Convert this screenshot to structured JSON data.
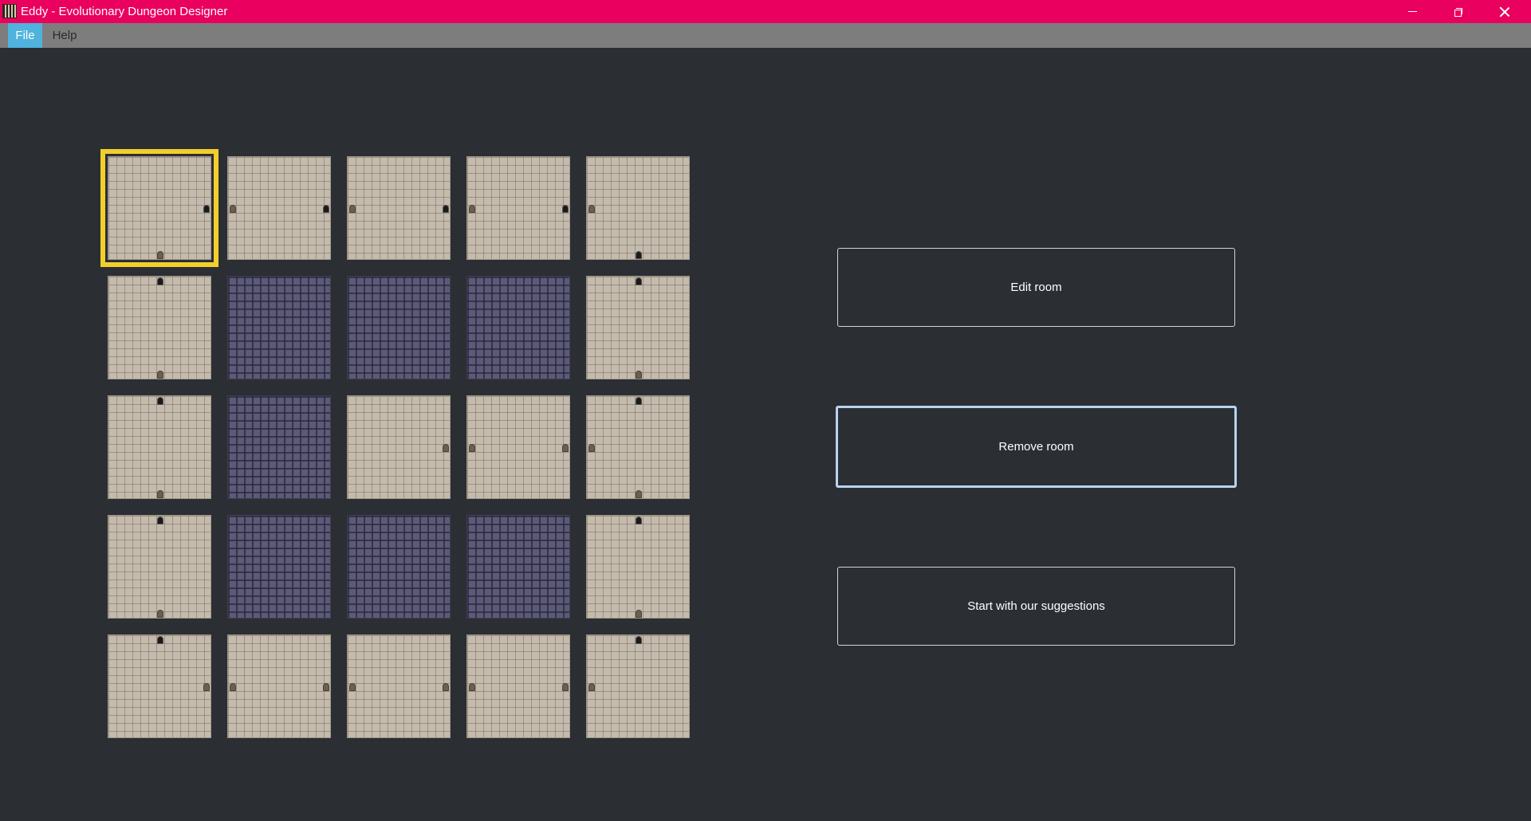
{
  "window": {
    "title": "Eddy - Evolutionary Dungeon Designer",
    "controls": {
      "minimize": "minimize-icon",
      "maximize": "restore-icon",
      "close": "close-icon"
    }
  },
  "menu": {
    "items": [
      "File",
      "Help"
    ],
    "active": "File"
  },
  "colors": {
    "titlebar": "#ea005e",
    "background": "#2b2e33",
    "menubar": "#7d7d7d",
    "menu_active": "#4fb3dd",
    "selection": "#f2cf2c",
    "focus_border": "#b9d3f0"
  },
  "grid": {
    "rows": 5,
    "cols": 5,
    "selected": [
      0,
      0
    ],
    "rooms": [
      [
        {
          "type": "stone",
          "doors": [
            [
              "right",
              "open"
            ],
            [
              "bottom",
              "closed"
            ]
          ]
        },
        {
          "type": "stone",
          "doors": [
            [
              "left",
              "closed"
            ],
            [
              "right",
              "open"
            ]
          ]
        },
        {
          "type": "stone",
          "doors": [
            [
              "left",
              "closed"
            ],
            [
              "right",
              "open"
            ]
          ]
        },
        {
          "type": "stone",
          "doors": [
            [
              "left",
              "closed"
            ],
            [
              "right",
              "open"
            ]
          ]
        },
        {
          "type": "stone",
          "doors": [
            [
              "left",
              "closed"
            ],
            [
              "bottom",
              "open"
            ]
          ]
        }
      ],
      [
        {
          "type": "stone",
          "doors": [
            [
              "top",
              "open"
            ],
            [
              "bottom",
              "closed"
            ]
          ]
        },
        {
          "type": "dark",
          "doors": []
        },
        {
          "type": "dark",
          "doors": []
        },
        {
          "type": "dark",
          "doors": []
        },
        {
          "type": "stone",
          "doors": [
            [
              "top",
              "open"
            ],
            [
              "bottom",
              "closed"
            ]
          ]
        }
      ],
      [
        {
          "type": "stone",
          "doors": [
            [
              "top",
              "open"
            ],
            [
              "bottom",
              "closed"
            ]
          ]
        },
        {
          "type": "dark",
          "doors": []
        },
        {
          "type": "stone",
          "doors": [
            [
              "right",
              "closed"
            ]
          ]
        },
        {
          "type": "stone",
          "doors": [
            [
              "left",
              "closed"
            ],
            [
              "right",
              "closed"
            ]
          ]
        },
        {
          "type": "stone",
          "doors": [
            [
              "top",
              "open"
            ],
            [
              "left",
              "closed"
            ],
            [
              "bottom",
              "closed"
            ]
          ]
        }
      ],
      [
        {
          "type": "stone",
          "doors": [
            [
              "top",
              "open"
            ],
            [
              "bottom",
              "closed"
            ]
          ]
        },
        {
          "type": "dark",
          "doors": []
        },
        {
          "type": "dark",
          "doors": []
        },
        {
          "type": "dark",
          "doors": []
        },
        {
          "type": "stone",
          "doors": [
            [
              "top",
              "open"
            ],
            [
              "bottom",
              "closed"
            ]
          ]
        }
      ],
      [
        {
          "type": "stone",
          "doors": [
            [
              "top",
              "open"
            ],
            [
              "right",
              "closed"
            ]
          ]
        },
        {
          "type": "stone",
          "doors": [
            [
              "left",
              "closed"
            ],
            [
              "right",
              "closed"
            ]
          ]
        },
        {
          "type": "stone",
          "doors": [
            [
              "left",
              "closed"
            ],
            [
              "right",
              "closed"
            ]
          ]
        },
        {
          "type": "stone",
          "doors": [
            [
              "left",
              "closed"
            ],
            [
              "right",
              "closed"
            ]
          ]
        },
        {
          "type": "stone",
          "doors": [
            [
              "top",
              "open"
            ],
            [
              "left",
              "closed"
            ]
          ]
        }
      ]
    ]
  },
  "actions": {
    "edit_room": "Edit room",
    "remove_room": "Remove room",
    "suggestions": "Start with our suggestions"
  }
}
